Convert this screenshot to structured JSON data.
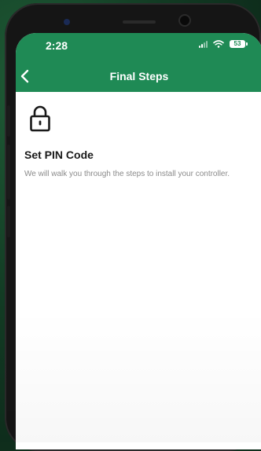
{
  "status_bar": {
    "time": "2:28",
    "battery": "53"
  },
  "header": {
    "title": "Final Steps",
    "back_icon": "chevron-left-icon",
    "color": "#1f8a55"
  },
  "content": {
    "icon": "lock-icon",
    "title": "Set PIN Code",
    "description": "We will walk you through the steps to install your controller."
  }
}
